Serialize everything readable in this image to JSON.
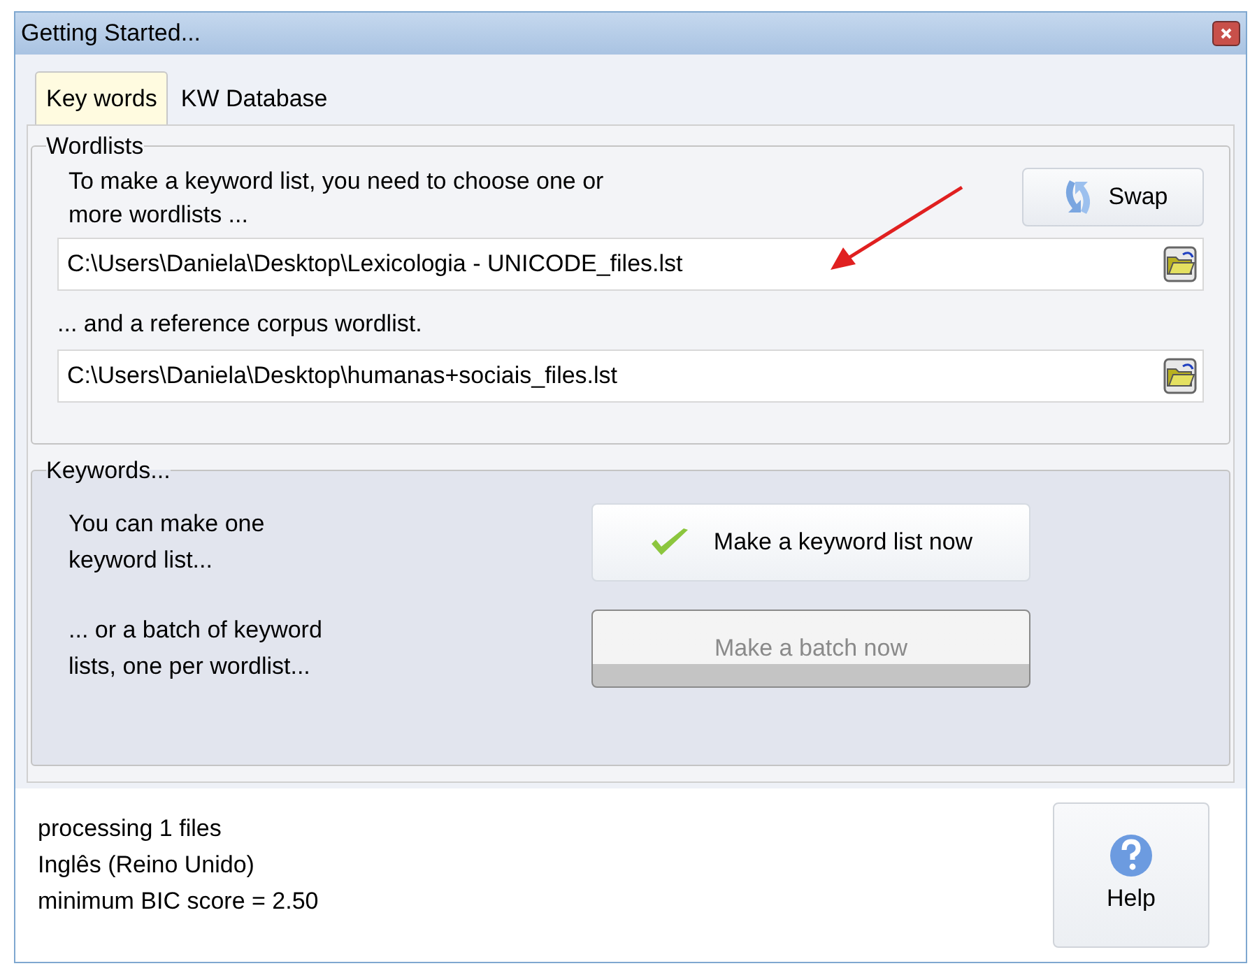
{
  "window": {
    "title": "Getting Started..."
  },
  "tabs": [
    {
      "label": "Key words",
      "selected": true
    },
    {
      "label": "KW Database",
      "selected": false
    }
  ],
  "wordlists": {
    "legend": "Wordlists",
    "intro_lines": [
      "To make a keyword list, you need to choose one or",
      "more wordlists ..."
    ],
    "swap_button": "Swap",
    "wordlist_path": "C:\\Users\\Daniela\\Desktop\\Lexicologia - UNICODE_files.lst",
    "reference_label": "... and a reference corpus wordlist.",
    "reference_path": "C:\\Users\\Daniela\\Desktop\\humanas+sociais_files.lst"
  },
  "keywords": {
    "legend": "Keywords...",
    "actions": [
      {
        "text_lines": [
          "You can make one",
          "keyword list..."
        ],
        "button": "Make a keyword list now",
        "disabled": false
      },
      {
        "text_lines": [
          "... or a batch of keyword",
          "lists, one per wordlist..."
        ],
        "button": "Make a batch now",
        "disabled": true
      }
    ]
  },
  "status_lines": [
    "processing 1 files",
    "Inglês (Reino Unido)",
    "minimum BIC score = 2.50"
  ],
  "help_button": "Help"
}
